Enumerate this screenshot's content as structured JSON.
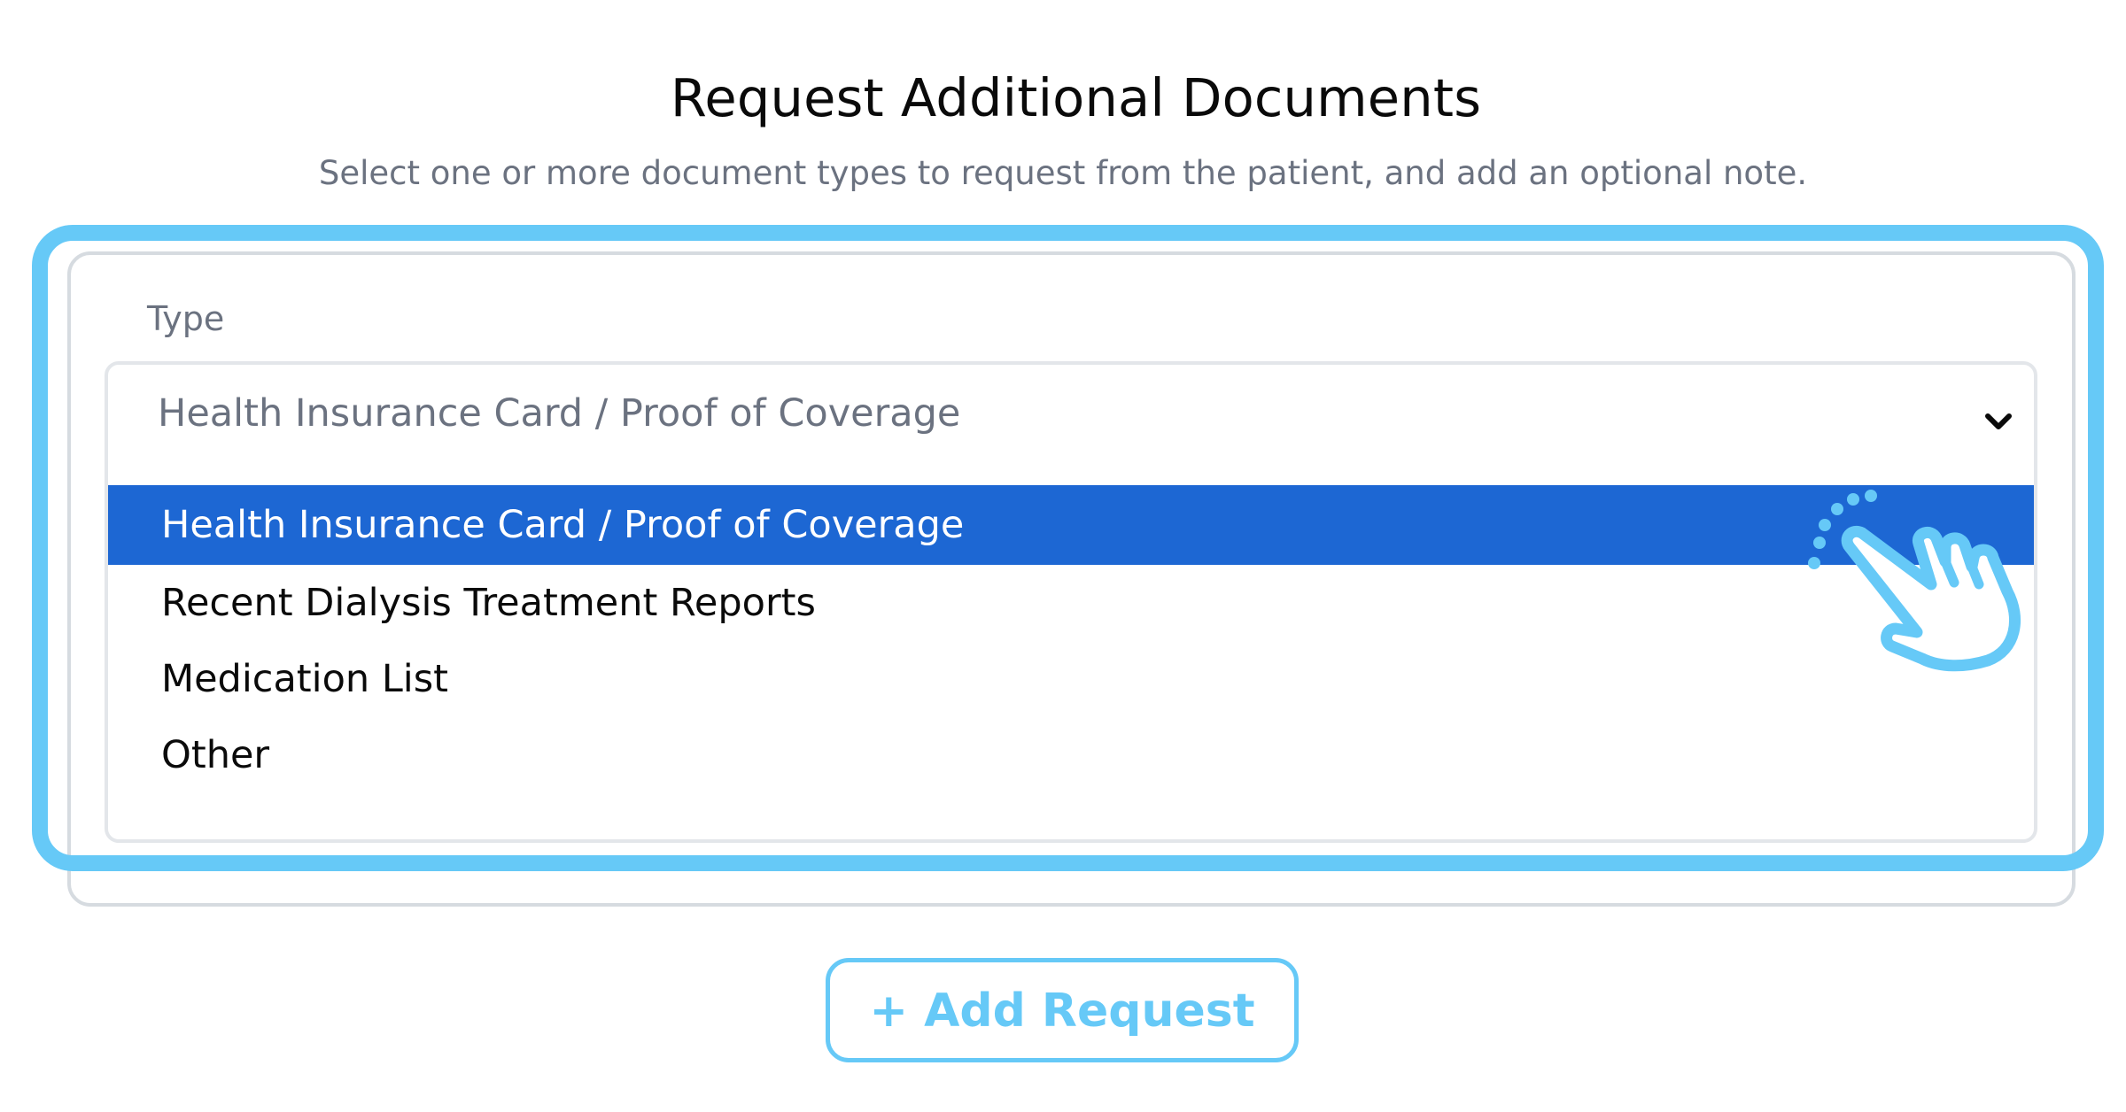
{
  "header": {
    "title": "Request Additional Documents",
    "subtitle": "Select one or more document types to request from the patient, and add an optional note."
  },
  "form": {
    "type_label": "Type",
    "type_select": {
      "selected_value": "Health Insurance Card / Proof of Coverage",
      "options": [
        {
          "label": "Health Insurance Card / Proof of Coverage",
          "highlighted": true
        },
        {
          "label": "Recent Dialysis Treatment Reports",
          "highlighted": false
        },
        {
          "label": "Medication List",
          "highlighted": false
        },
        {
          "label": "Other",
          "highlighted": false
        }
      ]
    }
  },
  "actions": {
    "add_request_label": "+ Add Request"
  },
  "icons": {
    "chevron": "chevron-down-icon",
    "pointer": "hand-pointer-click-icon"
  },
  "colors": {
    "highlight_border": "#66c9f7",
    "option_active_bg": "#1d67d3",
    "button_accent": "#66c9f7",
    "muted_text": "#6b7280"
  }
}
